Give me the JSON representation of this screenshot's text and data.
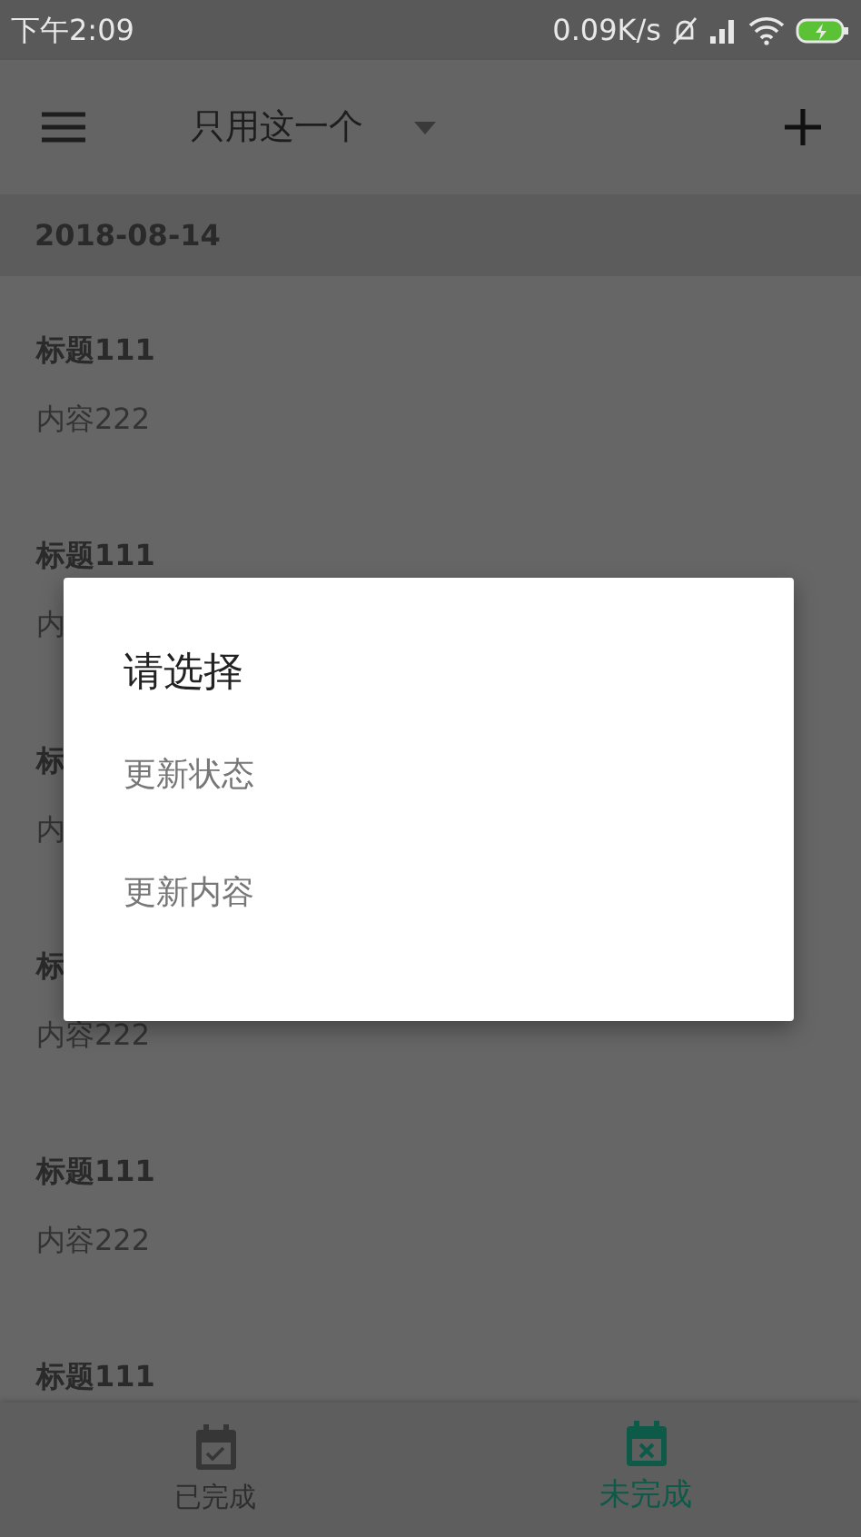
{
  "status_bar": {
    "time": "下午2:09",
    "speed": "0.09K/s"
  },
  "toolbar": {
    "title": "只用这一个"
  },
  "date_header": "2018-08-14",
  "items": [
    {
      "title": "标题111",
      "content": "内容222"
    },
    {
      "title": "标题111",
      "content": "内"
    },
    {
      "title": "标",
      "content": "内"
    },
    {
      "title": "标",
      "content": "内容222"
    },
    {
      "title": "标题111",
      "content": "内容222"
    },
    {
      "title": "标题111"
    }
  ],
  "dialog": {
    "title": "请选择",
    "options": [
      "更新状态",
      "更新内容"
    ]
  },
  "bottom_nav": [
    {
      "label": "已完成",
      "kind": "done",
      "selected": false
    },
    {
      "label": "未完成",
      "kind": "undone",
      "selected": true
    }
  ]
}
